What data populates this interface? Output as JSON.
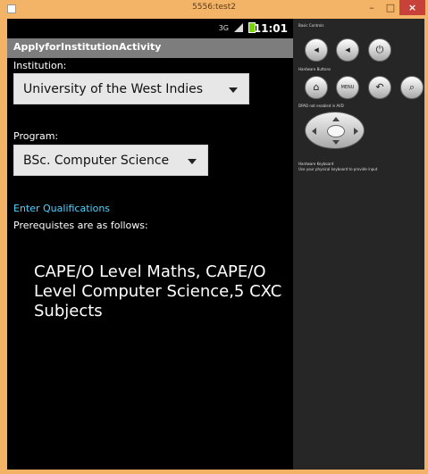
{
  "window": {
    "title": "5556:test2",
    "minimize_label": "–",
    "maximize_label": "□",
    "close_label": "×"
  },
  "status_bar": {
    "time": "11:01",
    "network_label": "3G"
  },
  "app": {
    "title": "ApplyforInstitutionActivity",
    "institution_label": "Institution:",
    "institution_value": "University of the West Indies",
    "program_label": "Program:",
    "program_value": "BSc. Computer Science",
    "qualifications_link": "Enter Qualifications",
    "prereq_label": "Prerequistes are as follows:",
    "prereq_text": "CAPE/O Level Maths, CAPE/O Level Computer Science,5 CXC Subjects"
  },
  "controls": {
    "basic_label": "Basic Controls",
    "hardware_buttons_label": "Hardware Buttons",
    "dpad_label": "DPAD not enabled in AVD",
    "keyboard_label": "Hardware Keyboard",
    "keyboard_hint": "Use your physical keyboard to provide input",
    "menu_label": "MENU"
  }
}
